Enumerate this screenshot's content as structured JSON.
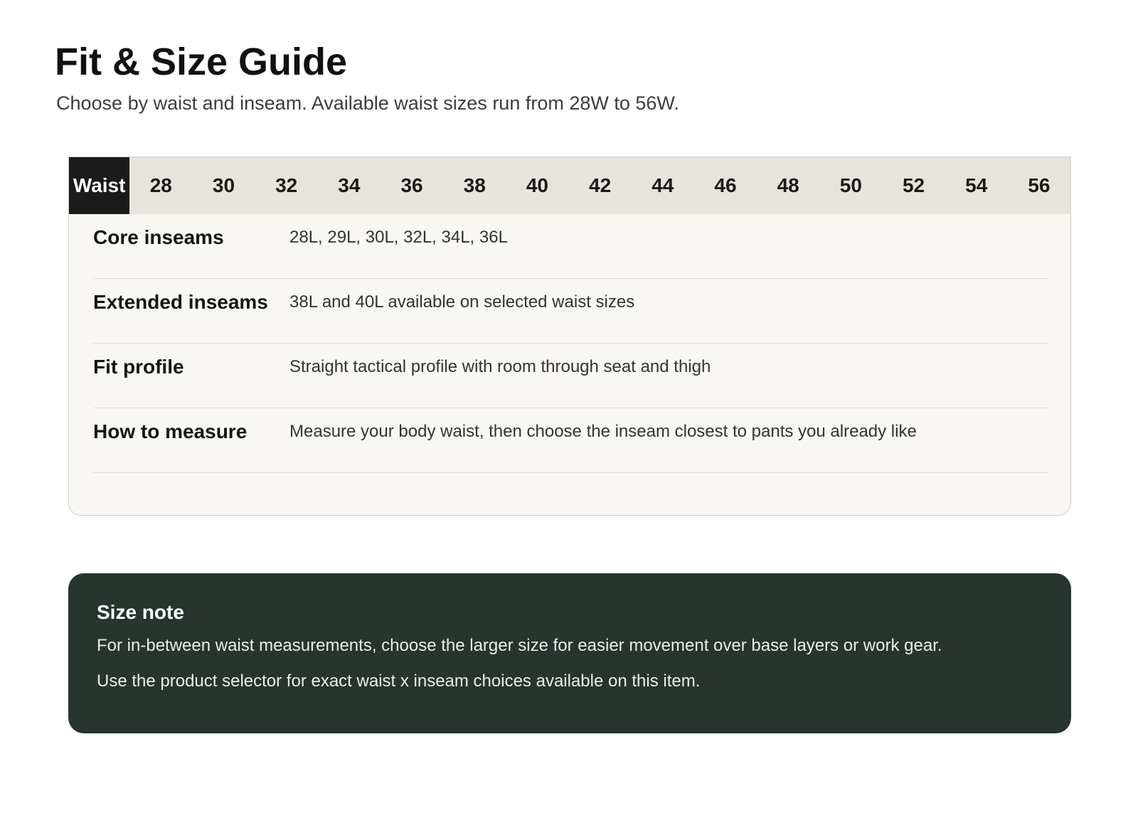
{
  "header": {
    "title": "Fit & Size Guide",
    "subtitle": "Choose by waist and inseam. Available waist sizes run from 28W to 56W."
  },
  "size_table": {
    "waist_label": "Waist",
    "waist_sizes": [
      "28",
      "30",
      "32",
      "34",
      "36",
      "38",
      "40",
      "42",
      "44",
      "46",
      "48",
      "50",
      "52",
      "54",
      "56"
    ],
    "rows": [
      {
        "label": "Core inseams",
        "value": "28L, 29L, 30L, 32L, 34L, 36L"
      },
      {
        "label": "Extended inseams",
        "value": "38L and 40L available on selected waist sizes"
      },
      {
        "label": "Fit profile",
        "value": "Straight tactical profile with room through seat and thigh"
      },
      {
        "label": "How to measure",
        "value": "Measure your body waist, then choose the inseam closest to pants you already like"
      }
    ]
  },
  "size_note": {
    "title": "Size note",
    "lines": [
      "For in-between waist measurements, choose the larger size for easier movement over base layers or work gear.",
      "Use the product selector for exact waist x inseam choices available on this item."
    ]
  },
  "colors": {
    "header_bg": "#e6e4dc",
    "waist_label_bg": "#1b1b1b",
    "card_bg": "#f8f7f3",
    "note_bg": "#29342f"
  }
}
